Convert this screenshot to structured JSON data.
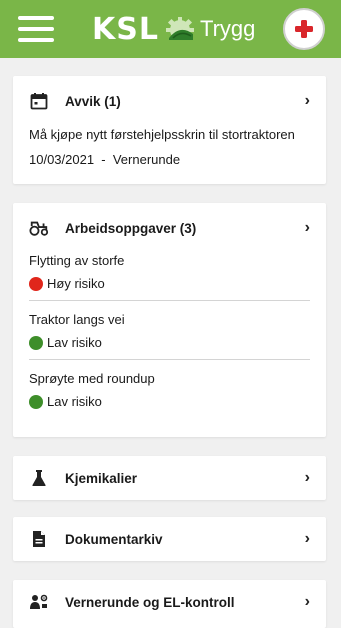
{
  "header": {
    "brand_name": "KSL",
    "brand_suffix": "Trygg",
    "brand_color": "#7ab648",
    "menu_icon": "hamburger-icon",
    "emergency_icon": "red-cross-icon"
  },
  "deviations": {
    "title": "Avvik (1)",
    "icon": "calendar-icon",
    "item_text": "Må kjøpe nytt førstehjelpsskrin til stortraktoren",
    "item_meta": "10/03/2021  -  Vernerunde"
  },
  "tasks": {
    "title": "Arbeidsoppgaver (3)",
    "icon": "tractor-icon",
    "items": [
      {
        "name": "Flytting av storfe",
        "risk": "Høy risiko",
        "risk_color": "#e0261b"
      },
      {
        "name": "Traktor langs vei",
        "risk": "Lav risiko",
        "risk_color": "#3e8e2a"
      },
      {
        "name": "Sprøyte med roundup",
        "risk": "Lav risiko",
        "risk_color": "#3e8e2a"
      }
    ]
  },
  "chemicals": {
    "title": "Kjemikalier",
    "icon": "flask-icon"
  },
  "documents": {
    "title": "Dokumentarkiv",
    "icon": "document-icon"
  },
  "inspection": {
    "title": "Vernerunde og EL-kontroll",
    "icon": "inspection-icon"
  },
  "chevron": "›"
}
